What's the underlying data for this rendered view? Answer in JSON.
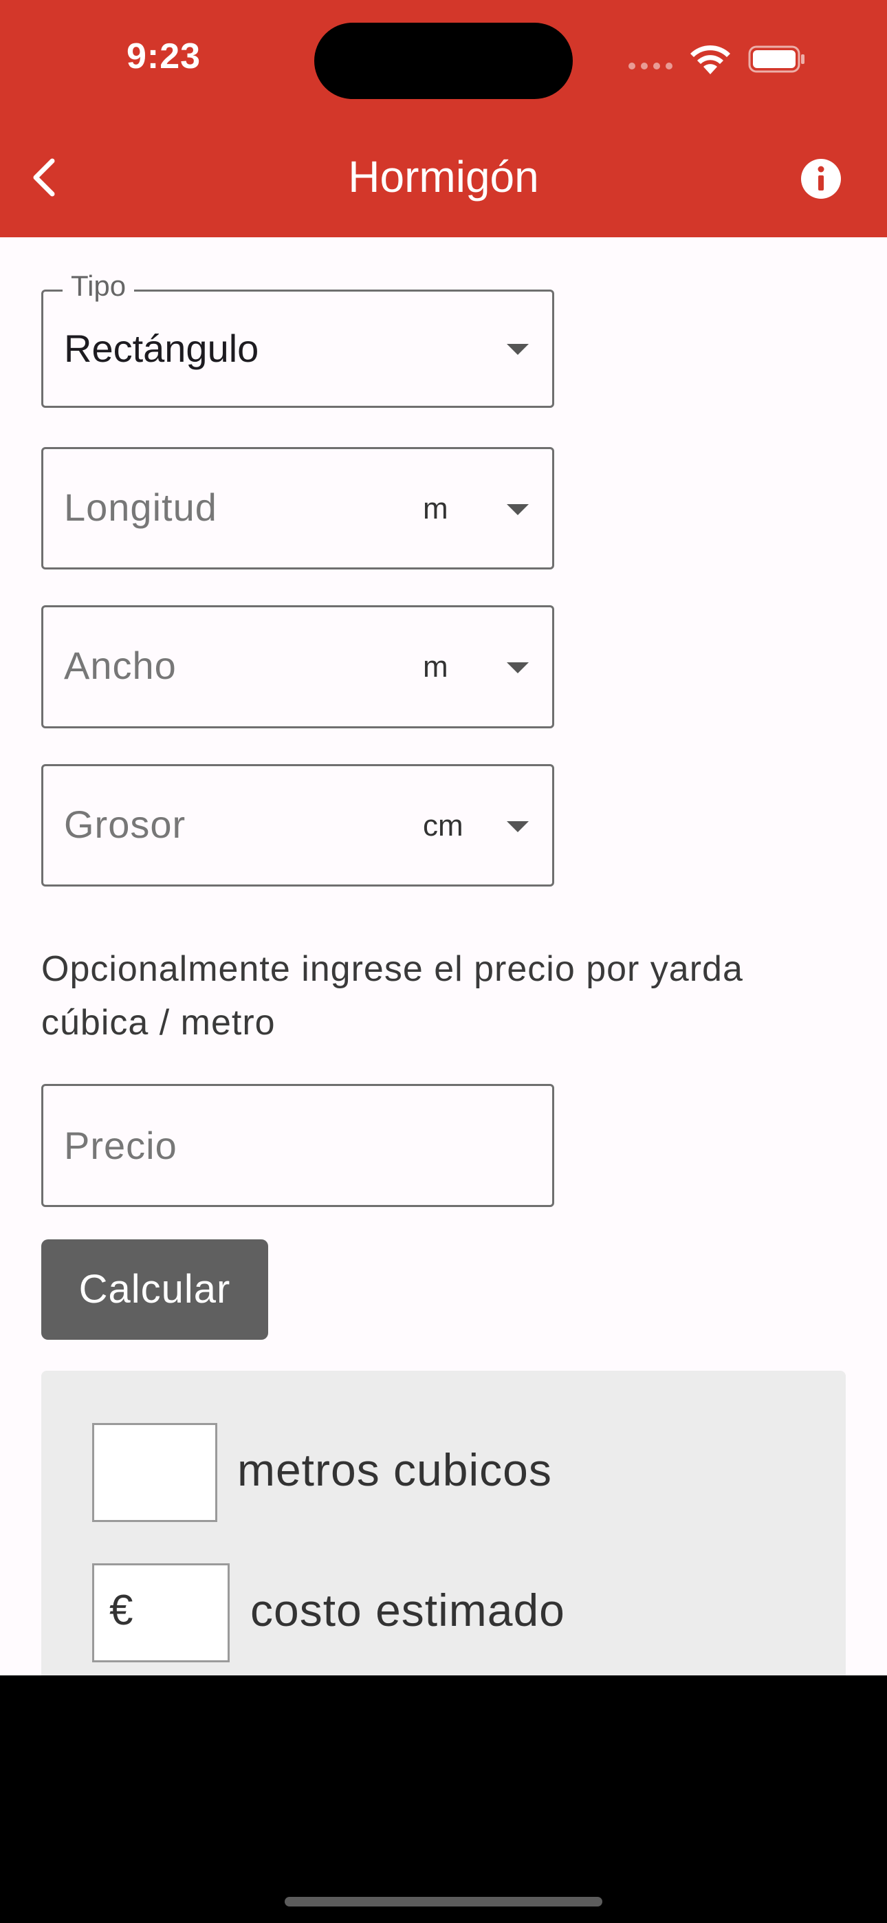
{
  "status_bar": {
    "time": "9:23"
  },
  "header": {
    "title": "Hormigón",
    "back_icon": "chevron-left-icon",
    "info_icon": "info-icon"
  },
  "form": {
    "tipo": {
      "label": "Tipo",
      "value": "Rectángulo"
    },
    "longitud": {
      "placeholder": "Longitud",
      "unit": "m"
    },
    "ancho": {
      "placeholder": "Ancho",
      "unit": "m"
    },
    "grosor": {
      "placeholder": "Grosor",
      "unit": "cm"
    },
    "hint": "Opcionalmente ingrese el precio por yarda cúbica / metro",
    "precio": {
      "placeholder": "Precio"
    },
    "calcular_label": "Calcular"
  },
  "results": {
    "volume_value": "",
    "volume_label": "metros cubicos",
    "cost_currency": "€",
    "cost_value": "",
    "cost_label": "costo estimado"
  },
  "colors": {
    "accent": "#d3372a",
    "button": "#606060",
    "background": "#fffbfe",
    "results_bg": "#ececec"
  }
}
